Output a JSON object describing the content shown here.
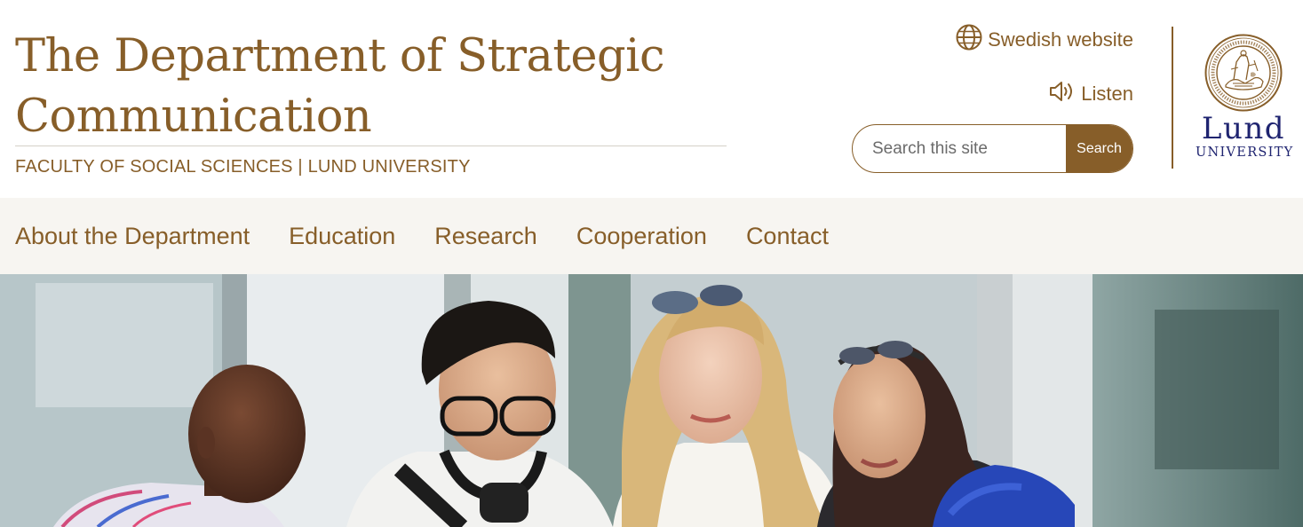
{
  "header": {
    "title": "The Department of Strategic Communication",
    "subtitle": "FACULTY OF SOCIAL SCIENCES | LUND UNIVERSITY",
    "language_link": "Swedish website",
    "listen_link": "Listen",
    "search": {
      "placeholder": "Search this site",
      "button_label": "Search"
    },
    "logo": {
      "name": "Lund",
      "subname": "University"
    }
  },
  "nav": {
    "items": [
      {
        "label": "About the Department"
      },
      {
        "label": "Education"
      },
      {
        "label": "Research"
      },
      {
        "label": "Cooperation"
      },
      {
        "label": "Contact"
      }
    ]
  },
  "hero": {
    "description": ""
  },
  "colors": {
    "brand": "#875e29",
    "nav_background": "#f7f5f1",
    "logo_blue": "#1f2470"
  },
  "icons": {
    "language": "globe-icon",
    "listen": "speaker-icon",
    "seal": "university-seal-icon"
  }
}
